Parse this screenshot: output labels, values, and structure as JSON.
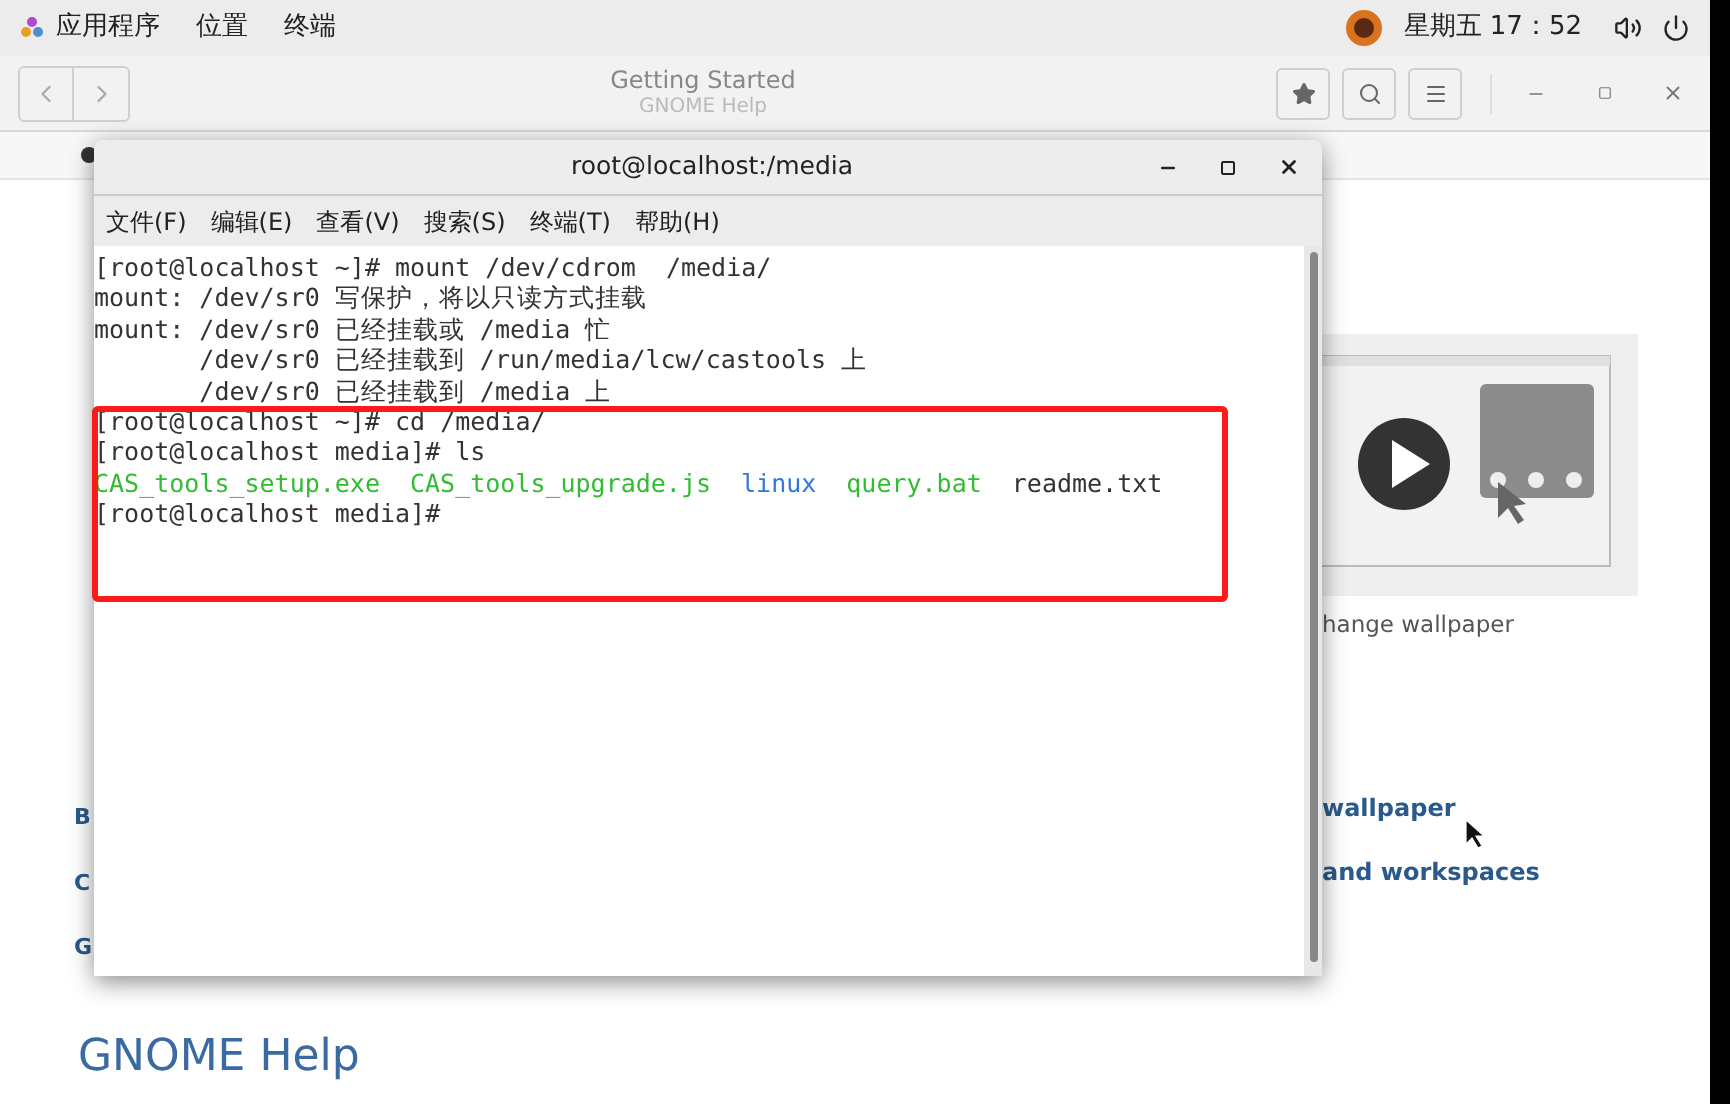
{
  "top_bar": {
    "menus": [
      "应用程序",
      "位置",
      "终端"
    ],
    "clock": "星期五 17：52"
  },
  "help_window": {
    "title": "Getting Started",
    "subtitle": "GNOME Help",
    "left_fragments": [
      {
        "kind": "link",
        "text": "B"
      },
      {
        "kind": "link",
        "text": "C"
      },
      {
        "kind": "link",
        "text": "G"
      }
    ],
    "video_caption": "hange wallpaper",
    "links": [
      "wallpaper",
      "and workspaces"
    ],
    "footer_link": "GNOME Help"
  },
  "terminal": {
    "title": "root@localhost:/media",
    "menus": [
      "文件(F)",
      "编辑(E)",
      "查看(V)",
      "搜索(S)",
      "终端(T)",
      "帮助(H)"
    ],
    "lines": [
      {
        "kind": "text",
        "text": "[root@localhost ~]# mount /dev/cdrom  /media/"
      },
      {
        "kind": "text",
        "text": "mount: /dev/sr0 写保护，将以只读方式挂载"
      },
      {
        "kind": "text",
        "text": "mount: /dev/sr0 已经挂载或 /media 忙"
      },
      {
        "kind": "text",
        "text": "       /dev/sr0 已经挂载到 /run/media/lcw/castools 上"
      },
      {
        "kind": "text",
        "text": "       /dev/sr0 已经挂载到 /media 上"
      },
      {
        "kind": "text",
        "text": "[root@localhost ~]# cd /media/"
      },
      {
        "kind": "text",
        "text": "[root@localhost media]# ls"
      },
      {
        "kind": "files",
        "files": [
          {
            "name": "CAS_tools_setup.exe",
            "color": "#33bb33"
          },
          {
            "name": "CAS_tools_upgrade.js",
            "color": "#33bb33"
          },
          {
            "name": "linux",
            "color": "#3377dd"
          },
          {
            "name": "query.bat",
            "color": "#33bb33"
          },
          {
            "name": "readme.txt",
            "color": "#333333"
          }
        ]
      },
      {
        "kind": "text",
        "text": "[root@localhost media]# "
      }
    ]
  }
}
